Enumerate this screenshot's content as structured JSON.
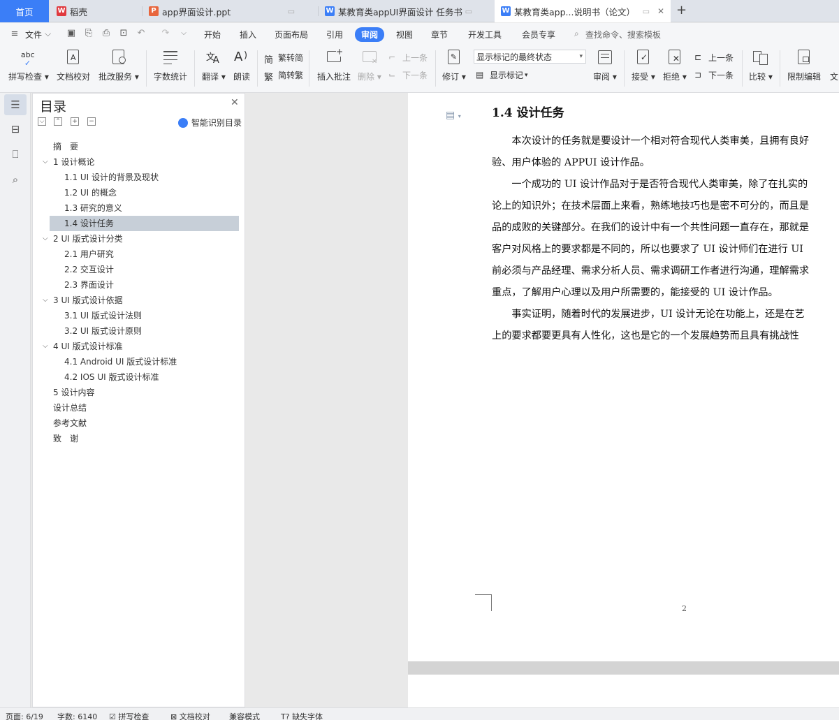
{
  "tabs": {
    "home": "首页",
    "items": [
      {
        "icon_label": "W",
        "label": "稻壳",
        "icon_color": "#e0393e"
      },
      {
        "icon_label": "P",
        "label": "app界面设计.ppt",
        "icon_color": "#e8663d"
      },
      {
        "icon_label": "W",
        "label": "某教育类appUI界面设计 任务书",
        "icon_color": "#3b7ef7"
      },
      {
        "icon_label": "W",
        "label": "某教育类app...说明书（论文）",
        "icon_color": "#3b7ef7"
      }
    ],
    "new_tab": "+"
  },
  "menu": {
    "file": "文件",
    "items": [
      "开始",
      "插入",
      "页面布局",
      "引用",
      "审阅",
      "视图",
      "章节",
      "开发工具",
      "会员专享"
    ],
    "active": "审阅",
    "search": "查找命令、搜索模板"
  },
  "ribbon": {
    "spell_check": "拼写检查",
    "doc_proof": "文档校对",
    "review_service": "批改服务",
    "word_count": "字数统计",
    "translate": "翻译",
    "read_aloud": "朗读",
    "to_simplified": "繁转简",
    "to_traditional": "简转繁",
    "insert_comment": "插入批注",
    "delete": "删除",
    "prev_comment": "上一条",
    "next_comment": "下一条",
    "track_changes": "修订",
    "markup_state": "显示标记的最终状态",
    "show_markup": "显示标记",
    "review": "审阅",
    "accept": "接受",
    "reject": "拒绝",
    "prev_change": "上一条",
    "next_change": "下一条",
    "compare": "比较",
    "restrict_editing": "限制编辑",
    "overflow": "文"
  },
  "toc": {
    "title": "目录",
    "smart": "智能识别目录",
    "items": [
      {
        "label": "摘　要",
        "caret": ""
      },
      {
        "label": "1  设计概论",
        "caret": "v"
      },
      {
        "label": "1.1 UI 设计的背景及现状",
        "caret": ""
      },
      {
        "label": "1.2 UI 的概念",
        "caret": ""
      },
      {
        "label": "1.3 研究的意义",
        "caret": ""
      },
      {
        "label": "1.4 设计任务",
        "caret": ""
      },
      {
        "label": "2 UI 版式设计分类",
        "caret": "v"
      },
      {
        "label": "2.1 用户研究",
        "caret": ""
      },
      {
        "label": "2.2  交互设计",
        "caret": ""
      },
      {
        "label": "2.3  界面设计",
        "caret": ""
      },
      {
        "label": "3 UI 版式设计依据",
        "caret": "v"
      },
      {
        "label": "3.1 UI 版式设计法则",
        "caret": ""
      },
      {
        "label": "3.2 UI 版式设计原则",
        "caret": ""
      },
      {
        "label": "4 UI 版式设计标准",
        "caret": "v"
      },
      {
        "label": "4.1 Android UI 版式设计标准",
        "caret": ""
      },
      {
        "label": "4.2 IOS UI 版式设计标准",
        "caret": ""
      },
      {
        "label": "5  设计内容",
        "caret": ""
      },
      {
        "label": "设计总结",
        "caret": ""
      },
      {
        "label": "参考文献",
        "caret": ""
      },
      {
        "label": "致　谢",
        "caret": ""
      }
    ]
  },
  "document": {
    "heading": "1.4 设计任务",
    "lines": [
      "　　本次设计的任务就是要设计一个相对符合现代人类审美，且拥有良好",
      "验、用户体验的 APPUI 设计作品。",
      "　　一个成功的 UI 设计作品对于是否符合现代人类审美，除了在扎实的",
      "论上的知识外；在技术层面上来看，熟练地技巧也是密不可分的，而且是",
      "品的成败的关键部分。在我们的设计中有一个共性问题一直存在，那就是",
      "客户对风格上的要求都是不同的，所以也要求了 UI 设计师们在进行 UI",
      "前必须与产品经理、需求分析人员、需求调研工作者进行沟通，理解需求",
      "重点，了解用户心理以及用户所需要的，能接受的 UI 设计作品。",
      "　　事实证明，随着时代的发展进步，UI 设计无论在功能上，还是在艺",
      "上的要求都要更具有人性化，这也是它的一个发展趋势而且具有挑战性"
    ],
    "page_number": "2"
  },
  "status": {
    "page": "页面: 6/19",
    "words": "字数: 6140",
    "spell": "拼写检查",
    "proof": "文档校对",
    "compat": "兼容模式",
    "missing_font": "缺失字体"
  }
}
